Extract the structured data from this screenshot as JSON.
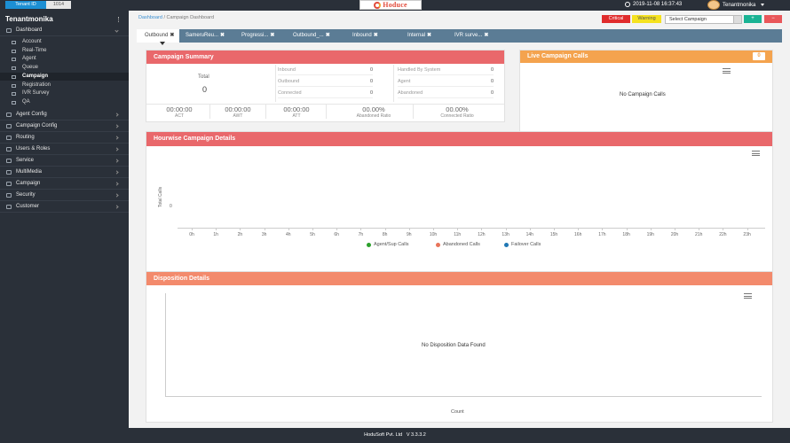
{
  "topbar": {
    "tenant_id_label": "Tenant ID",
    "tenant_id_value": "1014",
    "logo_text": "Hoduce",
    "datetime": "2019-11-08 16:37:43",
    "user_name": "Tenantmonika"
  },
  "sidebar": {
    "brand": "Tenantmonika",
    "dashboard": "Dashboard",
    "dashboard_items": [
      "Account",
      "Real-Time",
      "Agent",
      "Queue",
      "Campaign",
      "Registration",
      "IVR Survey",
      "QA"
    ],
    "active_item": "Campaign",
    "menu": [
      "Agent Config",
      "Campaign Config",
      "Routing",
      "Users & Roles",
      "Service",
      "MultiMedia",
      "Campaign",
      "Security",
      "Customer"
    ]
  },
  "header": {
    "breadcrumb_link": "Dashboard",
    "breadcrumb_current": "/ Campaign Dashboard",
    "critical_label": "Critical",
    "warning_label": "Warning",
    "select_campaign": "Select Campaign",
    "add_button": "+",
    "remove_button": "−"
  },
  "tabs": [
    {
      "label": "Outbound",
      "active": true
    },
    {
      "label": "SameruReu..."
    },
    {
      "label": "Progressi..."
    },
    {
      "label": "Outbound_..."
    },
    {
      "label": "Inbound"
    },
    {
      "label": "Internal"
    },
    {
      "label": "IVR surve..."
    }
  ],
  "campaign_summary": {
    "title": "Campaign Summary",
    "total_label": "Total",
    "total_value": "0",
    "left_col": [
      {
        "label": "Inbound",
        "value": "0"
      },
      {
        "label": "Outbound",
        "value": "0"
      },
      {
        "label": "Connected",
        "value": "0"
      }
    ],
    "right_col": [
      {
        "label": "Handled By System",
        "value": "0"
      },
      {
        "label": "Agent",
        "value": "0"
      },
      {
        "label": "Abandoned",
        "value": "0"
      }
    ],
    "metrics": [
      {
        "value": "00:00:00",
        "label": "ACT"
      },
      {
        "value": "00:00:00",
        "label": "AWT"
      },
      {
        "value": "00:00:00",
        "label": "ATT"
      },
      {
        "value": "00.00%",
        "label": "Abandoned Ratio"
      },
      {
        "value": "00.00%",
        "label": "Connected Ratio"
      }
    ]
  },
  "live_campaign": {
    "title": "Live Campaign Calls",
    "count": "0",
    "empty_message": "No Campaign Calls"
  },
  "hourwise": {
    "title": "Hourwise Campaign Details",
    "ylabel": "Total Calls",
    "ytick": "0",
    "hours": [
      "0h",
      "1h",
      "2h",
      "3h",
      "4h",
      "5h",
      "6h",
      "7h",
      "8h",
      "9h",
      "10h",
      "11h",
      "12h",
      "13h",
      "14h",
      "15h",
      "16h",
      "17h",
      "18h",
      "19h",
      "20h",
      "21h",
      "22h",
      "23h"
    ],
    "legend": [
      {
        "name": "Agent/Sup Calls",
        "color": "#2ca02c"
      },
      {
        "name": "Abandoned Calls",
        "color": "#e8745a"
      },
      {
        "name": "Failover Calls",
        "color": "#1f77b4"
      }
    ]
  },
  "disposition": {
    "title": "Disposition Details",
    "empty_message": "No Disposition Data Found",
    "xlabel": "Count"
  },
  "footer": {
    "company": "HoduSoft Pvt. Ltd",
    "version": "V 3.3.3.2"
  }
}
